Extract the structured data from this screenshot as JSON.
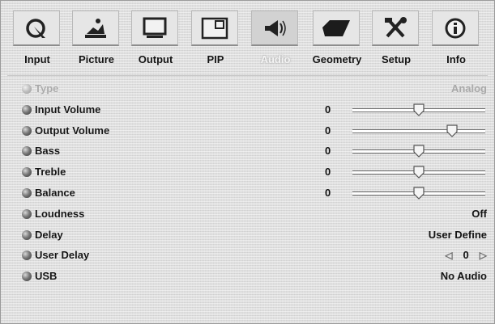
{
  "tabs": [
    {
      "label": "Input",
      "icon": "input-icon"
    },
    {
      "label": "Picture",
      "icon": "picture-icon"
    },
    {
      "label": "Output",
      "icon": "output-monitor-icon"
    },
    {
      "label": "PIP",
      "icon": "pip-icon"
    },
    {
      "label": "Audio",
      "icon": "speaker-icon",
      "active": true
    },
    {
      "label": "Geometry",
      "icon": "geometry-icon"
    },
    {
      "label": "Setup",
      "icon": "tools-icon"
    },
    {
      "label": "Info",
      "icon": "info-icon"
    }
  ],
  "rows": {
    "type": {
      "label": "Type",
      "value": "Analog",
      "disabled": true
    },
    "input_volume": {
      "label": "Input Volume",
      "value": "0",
      "slider_level": 0.5
    },
    "output_volume": {
      "label": "Output Volume",
      "value": "0",
      "slider_level": 0.75
    },
    "bass": {
      "label": "Bass",
      "value": "0",
      "slider_level": 0.5
    },
    "treble": {
      "label": "Treble",
      "value": "0",
      "slider_level": 0.5
    },
    "balance": {
      "label": "Balance",
      "value": "0",
      "slider_level": 0.5
    },
    "loudness": {
      "label": "Loudness",
      "value": "Off"
    },
    "delay": {
      "label": "Delay",
      "value": "User Define"
    },
    "user_delay": {
      "label": "User Delay",
      "value": "0",
      "left_arrow": "◁",
      "right_arrow": "▷"
    },
    "usb": {
      "label": "USB",
      "value": "No Audio"
    }
  }
}
